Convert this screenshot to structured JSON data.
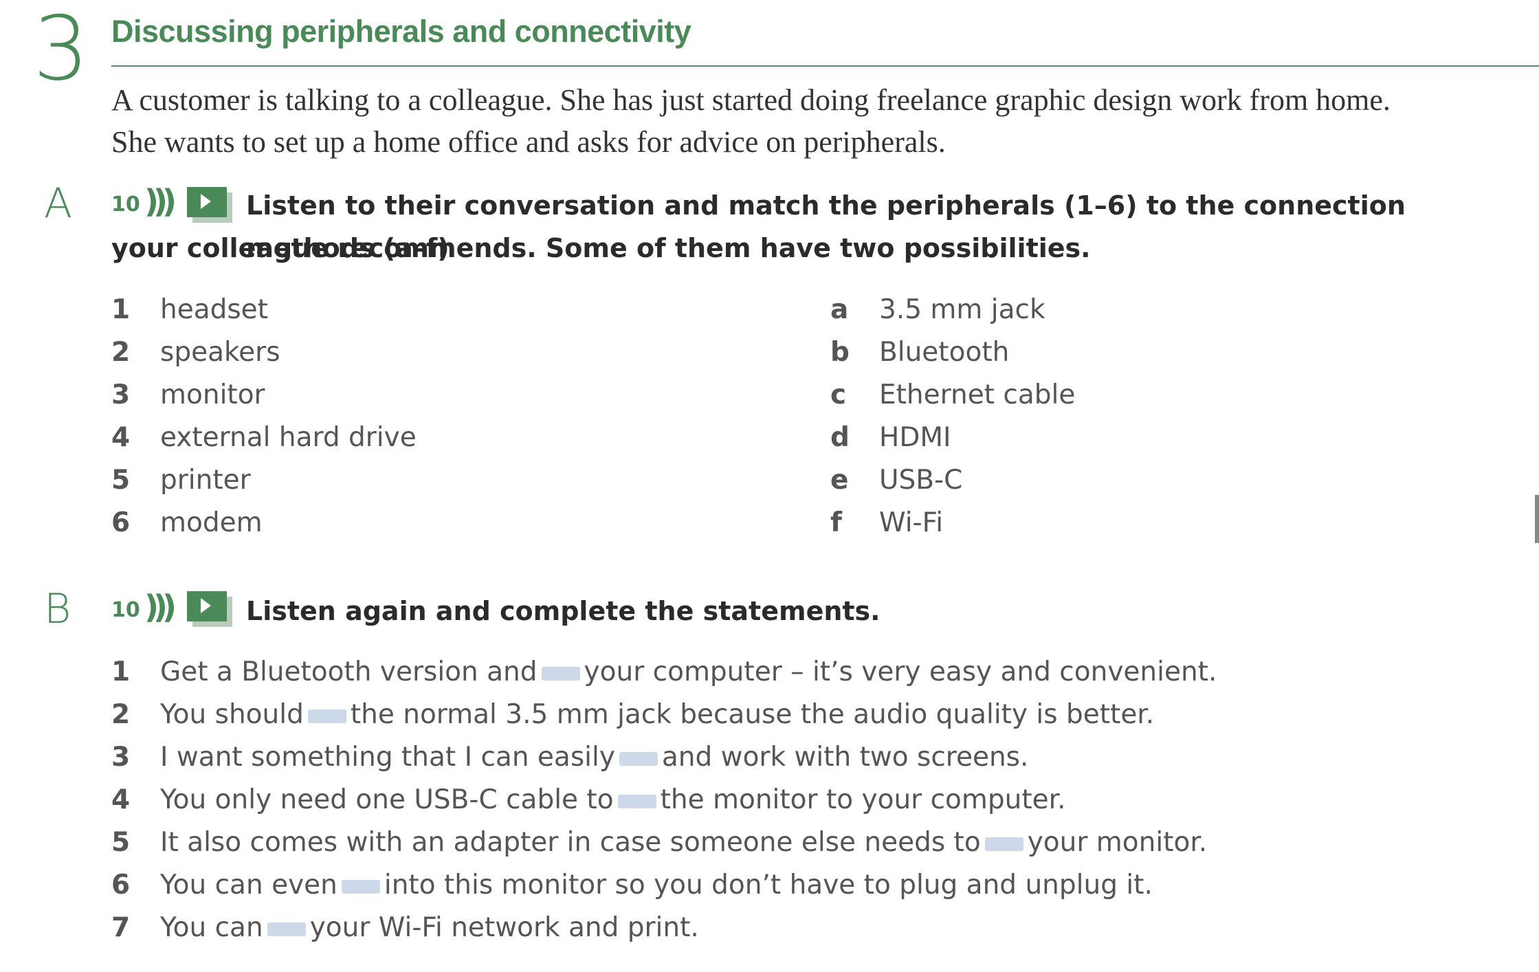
{
  "section": {
    "number": "3",
    "title": "Discussing peripherals and connectivity",
    "intro": [
      "A customer is talking to a colleague. She has just started doing freelance graphic design work from home.",
      "She wants to set up a home office and asks for advice on peripherals."
    ]
  },
  "exercise_a": {
    "letter": "A",
    "track": "10",
    "icons": [
      "audio-waves-icon",
      "video-play-icon"
    ],
    "instruction_line1": "Listen to their conversation and match the peripherals (1–6) to the connection methods (a–f)",
    "instruction_line2": "your colleague recommends. Some of them have two possibilities.",
    "peripherals": [
      {
        "n": "1",
        "text": "headset"
      },
      {
        "n": "2",
        "text": "speakers"
      },
      {
        "n": "3",
        "text": "monitor"
      },
      {
        "n": "4",
        "text": "external hard drive"
      },
      {
        "n": "5",
        "text": "printer"
      },
      {
        "n": "6",
        "text": "modem"
      }
    ],
    "methods": [
      {
        "n": "a",
        "text": "3.5 mm jack"
      },
      {
        "n": "b",
        "text": "Bluetooth"
      },
      {
        "n": "c",
        "text": "Ethernet cable"
      },
      {
        "n": "d",
        "text": "HDMI"
      },
      {
        "n": "e",
        "text": "USB-C"
      },
      {
        "n": "f",
        "text": "Wi-Fi"
      }
    ]
  },
  "exercise_b": {
    "letter": "B",
    "track": "10",
    "instruction": "Listen again and complete the statements.",
    "statements": [
      {
        "n": "1",
        "before": "Get a Bluetooth version and",
        "after": "your computer – it’s very easy and convenient."
      },
      {
        "n": "2",
        "before": "You should",
        "after": "the normal 3.5 mm jack because the audio quality is better."
      },
      {
        "n": "3",
        "before": "I want something that I can easily",
        "after": "and work with two screens."
      },
      {
        "n": "4",
        "before": "You only need one USB-C cable to",
        "after": "the monitor to your computer."
      },
      {
        "n": "5",
        "before": "It also comes with an adapter in case someone else needs to",
        "after": "your monitor."
      },
      {
        "n": "6",
        "before": "You can even",
        "after": "into this monitor so you don’t have to plug and unplug it."
      },
      {
        "n": "7",
        "before": "You can",
        "after": "your Wi-Fi network and print."
      }
    ]
  },
  "colors": {
    "accent": "#4a8a58",
    "blank": "#cdd9e8",
    "text": "#333333"
  }
}
